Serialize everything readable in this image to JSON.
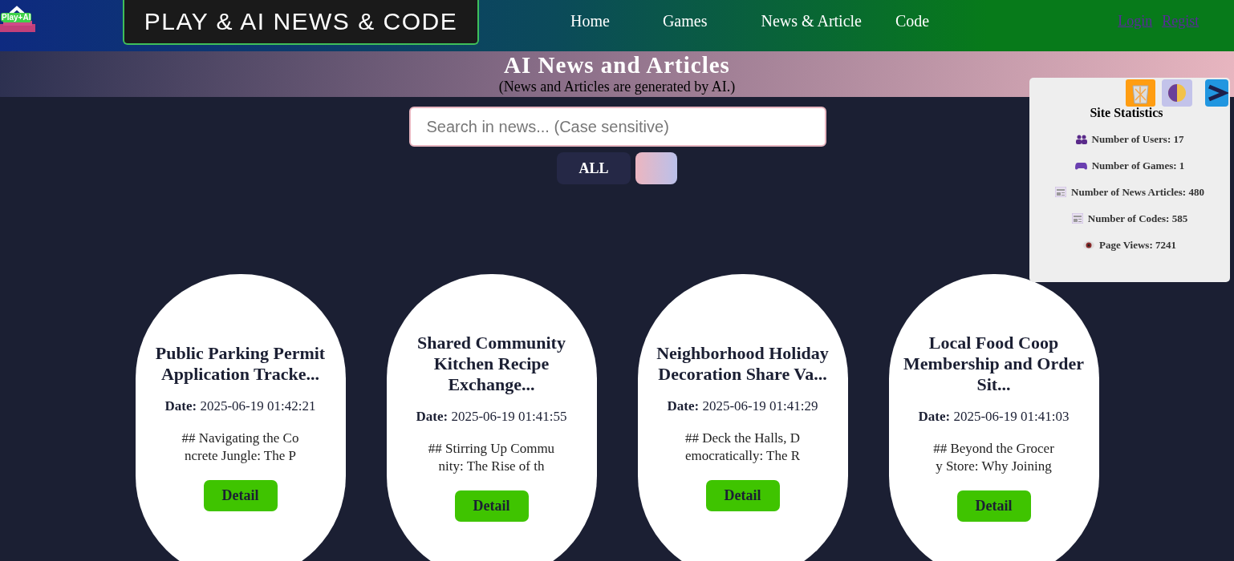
{
  "logo": {
    "text": "Play+AI"
  },
  "site_title": "PLAY & AI NEWS & CODE",
  "nav": [
    "Home",
    "Games",
    "News & Article",
    "Code"
  ],
  "auth_links": [
    "Login",
    "Regist"
  ],
  "banner": {
    "title": "AI News and Articles",
    "subtitle": "(News and Articles are generated by AI.)"
  },
  "search": {
    "placeholder": "Search in news... (Case sensitive)"
  },
  "filters": [
    {
      "label": "ALL",
      "kind": "text"
    },
    {
      "kind": "swatch"
    }
  ],
  "stats": {
    "title": "Site Statistics",
    "items": [
      {
        "kind": "users",
        "text": "Number of Users: 17"
      },
      {
        "kind": "games",
        "text": "Number of Games: 1"
      },
      {
        "kind": "news",
        "text": "Number of News Articles: 480"
      },
      {
        "kind": "codes",
        "text": "Number of Codes: 585"
      },
      {
        "kind": "views",
        "text": "Page Views: 7241"
      }
    ]
  },
  "articles": [
    {
      "title": "Public Parking Permit Application Tracke...",
      "date_label": "Date:",
      "date": "2025-06-19 01:42:21",
      "excerpt_lines": [
        "## Navigating the Co",
        "ncrete Jungle: The P"
      ],
      "button": "Detail"
    },
    {
      "title": "Shared Community Kitchen Recipe Exchange...",
      "date_label": "Date:",
      "date": "2025-06-19 01:41:55",
      "excerpt_lines": [
        "## Stirring Up Commu",
        "nity: The Rise of th"
      ],
      "button": "Detail"
    },
    {
      "title": "Neighborhood Holiday Decoration Share Va...",
      "date_label": "Date:",
      "date": "2025-06-19 01:41:29",
      "excerpt_lines": [
        "## Deck the Halls, D",
        "emocratically: The R"
      ],
      "button": "Detail"
    },
    {
      "title": "Local Food Coop Membership and Order Sit...",
      "date_label": "Date:",
      "date": "2025-06-19 01:41:03",
      "excerpt_lines": [
        "## Beyond the Grocer",
        "y Store: Why Joining"
      ],
      "button": "Detail"
    }
  ]
}
